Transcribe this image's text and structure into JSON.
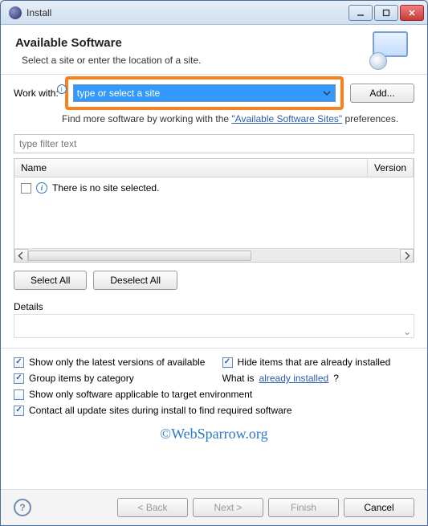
{
  "window": {
    "title": "Install"
  },
  "header": {
    "heading": "Available Software",
    "sub": "Select a site or enter the location of a site."
  },
  "workwith": {
    "label": "Work with:",
    "value": "type or select a site",
    "add": "Add..."
  },
  "hint": {
    "prefix": "Find more software by working with the ",
    "link": "\"Available Software Sites\"",
    "suffix": " preferences."
  },
  "filter": {
    "placeholder": "type filter text"
  },
  "tree": {
    "cols": {
      "name": "Name",
      "version": "Version"
    },
    "empty": "There is no site selected."
  },
  "buttons": {
    "selectAll": "Select All",
    "deselectAll": "Deselect All",
    "back": "< Back",
    "next": "Next >",
    "finish": "Finish",
    "cancel": "Cancel"
  },
  "details": {
    "label": "Details"
  },
  "checks": {
    "latest": "Show only the latest versions of available software",
    "hide": "Hide items that are already installed",
    "group": "Group items by category",
    "whatis_pre": "What is ",
    "whatis_link": "already installed",
    "whatis_post": "?",
    "applicable": "Show only software applicable to target environment",
    "contact": "Contact all update sites during install to find required software"
  },
  "watermark": "©WebSparrow.org"
}
